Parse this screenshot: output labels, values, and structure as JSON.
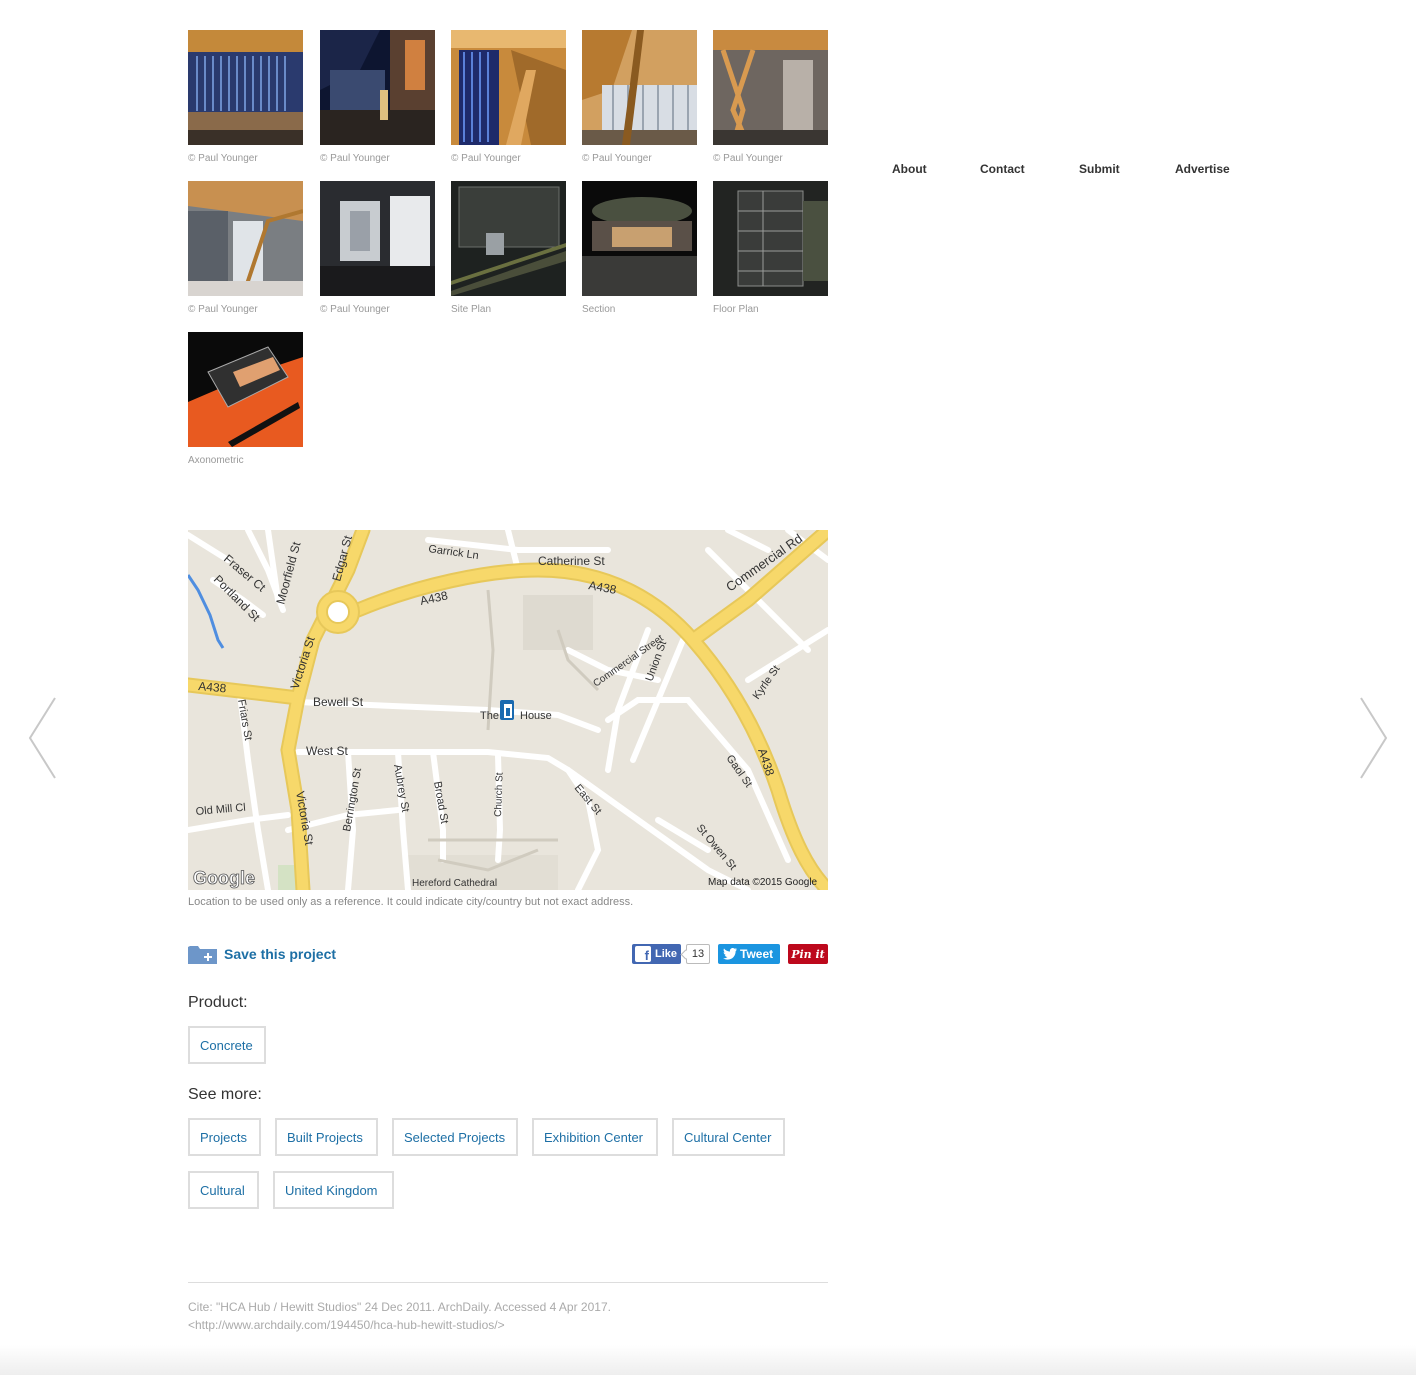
{
  "gallery": [
    {
      "caption": "© Paul Younger"
    },
    {
      "caption": "© Paul Younger"
    },
    {
      "caption": "© Paul Younger"
    },
    {
      "caption": "© Paul Younger"
    },
    {
      "caption": "© Paul Younger"
    },
    {
      "caption": "© Paul Younger"
    },
    {
      "caption": "© Paul Younger"
    },
    {
      "caption": "Site Plan"
    },
    {
      "caption": "Section"
    },
    {
      "caption": "Floor Plan"
    },
    {
      "caption": "Axonometric"
    }
  ],
  "nav": {
    "about": "About",
    "contact": "Contact",
    "submit": "Submit",
    "advertise": "Advertise"
  },
  "map": {
    "labels": {
      "fraser_ct": "Fraser Ct",
      "moorfield_st": "Moorfield St",
      "edgar_st": "Edgar St",
      "portland_st": "Portland St",
      "garrick_ln": "Garrick Ln",
      "catherine_st": "Catherine St",
      "a438_1": "A438",
      "a438_2": "A438",
      "a438_3": "A438",
      "a438_4": "A438",
      "commercial_rd": "Commercial Rd",
      "victoria_st_1": "Victoria St",
      "victoria_st_2": "Victoria St",
      "commercial_street": "Commercial Street",
      "union_st": "Union St",
      "kyrle_st": "Kyrle St",
      "bewell_st": "Bewell St",
      "the": "The",
      "house": "House",
      "friars_st": "Friars St",
      "west_st": "West St",
      "berrington_st": "Berrington St",
      "aubrey_st": "Aubrey St",
      "broad_st": "Broad St",
      "church_st": "Church St",
      "east_st": "East St",
      "gaol_st": "Gaol St",
      "st_owen_st": "St Owen St",
      "old_mill_cl": "Old Mill Cl",
      "hereford_cathedral": "Hereford Cathedral",
      "google": "Google",
      "map_data": "Map data ©2015 Google"
    },
    "colors": {
      "land": "#e9e5dc",
      "major_road": "#f7d86a",
      "minor_road": "#ffffff",
      "water": "#4f8ee0",
      "park": "#d4e2c4"
    },
    "note": "Location to be used only as a reference. It could indicate city/country but not exact address."
  },
  "actions": {
    "save_label": "Save this project",
    "fb_like": "Like",
    "fb_count": "13",
    "tweet": "Tweet",
    "pin": "Pin it"
  },
  "product": {
    "heading": "Product:",
    "tags": [
      "Concrete"
    ]
  },
  "see_more": {
    "heading": "See more:",
    "tags": [
      "Projects",
      "Built Projects",
      "Selected Projects",
      "Exhibition Center",
      "Cultural Center",
      "Cultural",
      "United Kingdom"
    ]
  },
  "cite": {
    "line1": "Cite: \"HCA Hub / Hewitt Studios\" 24 Dec 2011. ArchDaily. Accessed 4 Apr 2017.",
    "line2": "<http://www.archdaily.com/194450/hca-hub-hewitt-studios/>"
  },
  "accent_color": "#1d6fa5"
}
